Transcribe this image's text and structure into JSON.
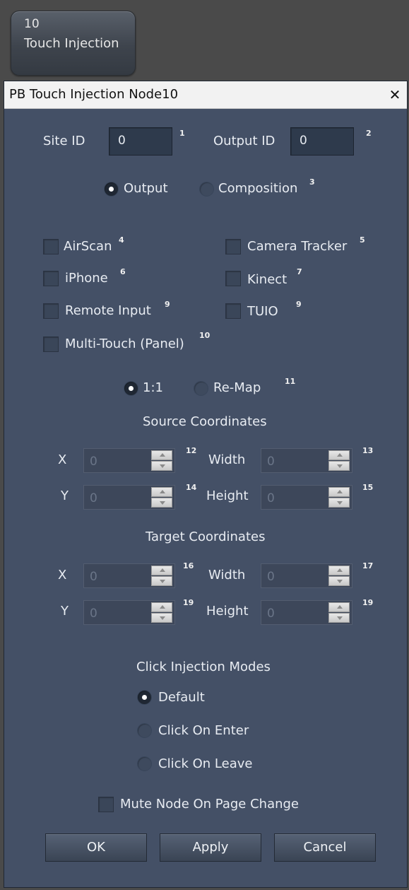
{
  "node": {
    "number": "10",
    "name": "Touch Injection"
  },
  "dialog": {
    "title": "PB Touch Injection Node10",
    "close_glyph": "✕"
  },
  "ids": {
    "site_label": "Site ID",
    "site_value": "0",
    "site_num": "1",
    "output_label": "Output ID",
    "output_value": "0",
    "output_num": "2"
  },
  "target": {
    "output_label": "Output",
    "composition_label": "Composition",
    "num": "3",
    "selected": "Output"
  },
  "sources": [
    {
      "label": "AirScan",
      "num": "4",
      "checked": false
    },
    {
      "label": "Camera Tracker",
      "num": "5",
      "checked": false
    },
    {
      "label": "iPhone",
      "num": "6",
      "checked": false
    },
    {
      "label": "Kinect",
      "num": "7",
      "checked": false
    },
    {
      "label": "Remote Input",
      "num": "9",
      "checked": false
    },
    {
      "label": "TUIO",
      "num": "9",
      "checked": false
    },
    {
      "label": "Multi-Touch (Panel)",
      "num": "10",
      "checked": false
    }
  ],
  "mapping": {
    "one_to_one_label": "1:1",
    "remap_label": "Re-Map",
    "num": "11",
    "selected": "1:1"
  },
  "source_coords": {
    "heading": "Source Coordinates",
    "x_label": "X",
    "x_value": "0",
    "x_num": "12",
    "width_label": "Width",
    "width_value": "0",
    "width_num": "13",
    "y_label": "Y",
    "y_value": "0",
    "y_num": "14",
    "height_label": "Height",
    "height_value": "0",
    "height_num": "15"
  },
  "target_coords": {
    "heading": "Target Coordinates",
    "x_label": "X",
    "x_value": "0",
    "x_num": "16",
    "width_label": "Width",
    "width_value": "0",
    "width_num": "17",
    "y_label": "Y",
    "y_value": "0",
    "y_num": "19",
    "height_label": "Height",
    "height_value": "0",
    "height_num": "19"
  },
  "click_modes": {
    "heading": "Click Injection Modes",
    "default_label": "Default",
    "enter_label": "Click On Enter",
    "leave_label": "Click On Leave",
    "selected": "Default"
  },
  "mute": {
    "label": "Mute Node On Page Change",
    "checked": false
  },
  "buttons": {
    "ok": "OK",
    "apply": "Apply",
    "cancel": "Cancel"
  },
  "colors": {
    "dialog_bg": "#445066",
    "titlebar_bg": "#f2f2f2",
    "field_bg": "#2e3a4c"
  }
}
